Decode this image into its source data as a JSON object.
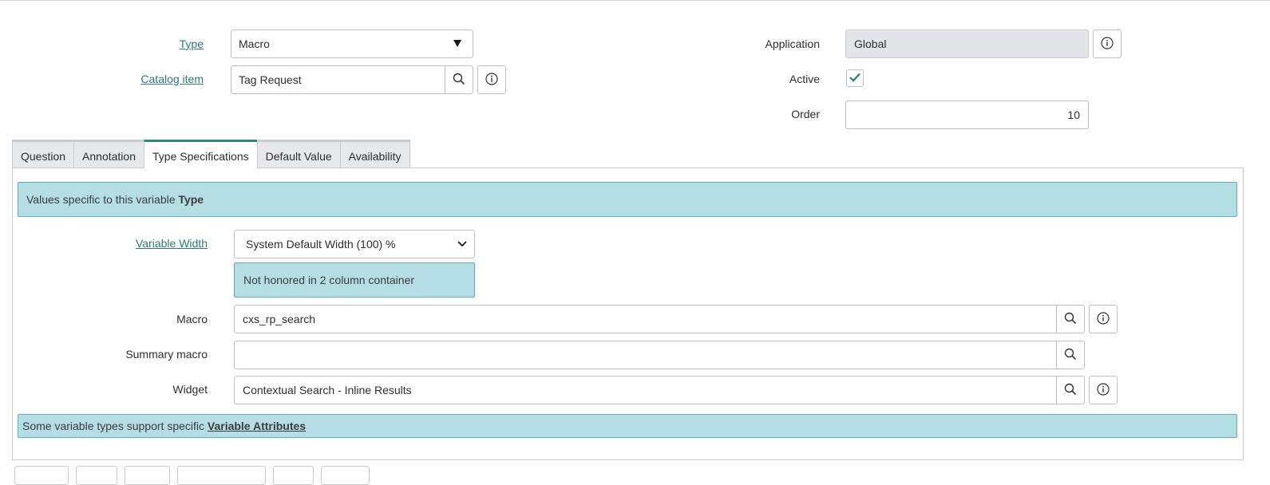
{
  "header": {
    "type": {
      "label": "Type",
      "value": "Macro"
    },
    "catalog_item": {
      "label": "Catalog item",
      "value": "Tag Request"
    },
    "application": {
      "label": "Application",
      "value": "Global"
    },
    "active": {
      "label": "Active",
      "checked": true
    },
    "order": {
      "label": "Order",
      "value": "10"
    }
  },
  "tabs": [
    {
      "label": "Question",
      "active": false
    },
    {
      "label": "Annotation",
      "active": false
    },
    {
      "label": "Type Specifications",
      "active": true
    },
    {
      "label": "Default Value",
      "active": false
    },
    {
      "label": "Availability",
      "active": false
    }
  ],
  "type_specs": {
    "banner_text": "Values specific to this variable",
    "banner_bold": "Type",
    "variable_width": {
      "label": "Variable Width",
      "value": "System Default Width (100) %"
    },
    "width_note": "Not honored in 2 column container",
    "macro": {
      "label": "Macro",
      "value": "cxs_rp_search"
    },
    "summary_macro": {
      "label": "Summary macro",
      "value": ""
    },
    "widget": {
      "label": "Widget",
      "value": "Contextual Search - Inline Results"
    },
    "footer_text": "Some variable types support specific",
    "footer_link": "Variable Attributes"
  },
  "colors": {
    "accent": "#278d7d",
    "link": "#2b7b75",
    "info_bg": "#b4dde4",
    "info_border": "#5ab1bf"
  }
}
